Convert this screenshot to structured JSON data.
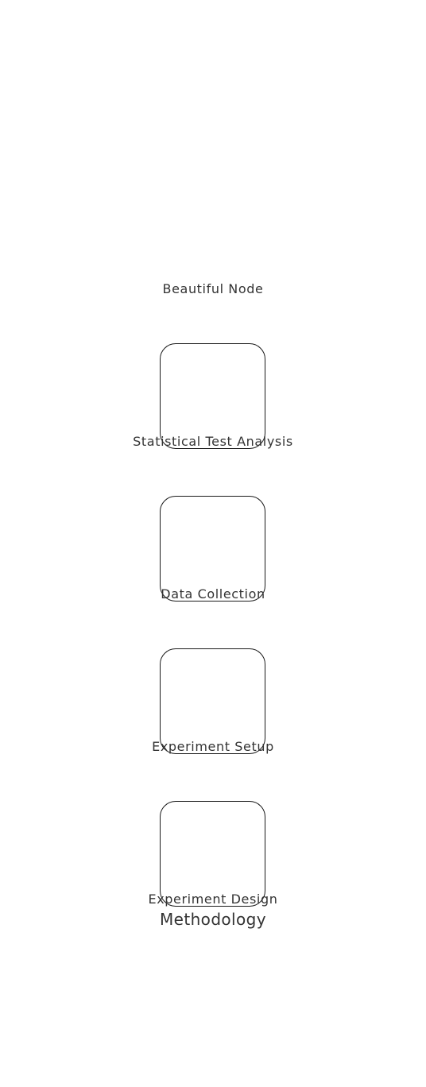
{
  "diagram": {
    "top_label": "Beautiful Node",
    "nodes": [
      {
        "label": "Statistical Test Analysis"
      },
      {
        "label": "Data Collection"
      },
      {
        "label": "Experiment Setup"
      },
      {
        "label": "Experiment Design"
      }
    ],
    "title": "Methodology"
  },
  "colors": {
    "background": "#ffffff",
    "node_border": "#1a1a1a",
    "text": "#333333"
  }
}
